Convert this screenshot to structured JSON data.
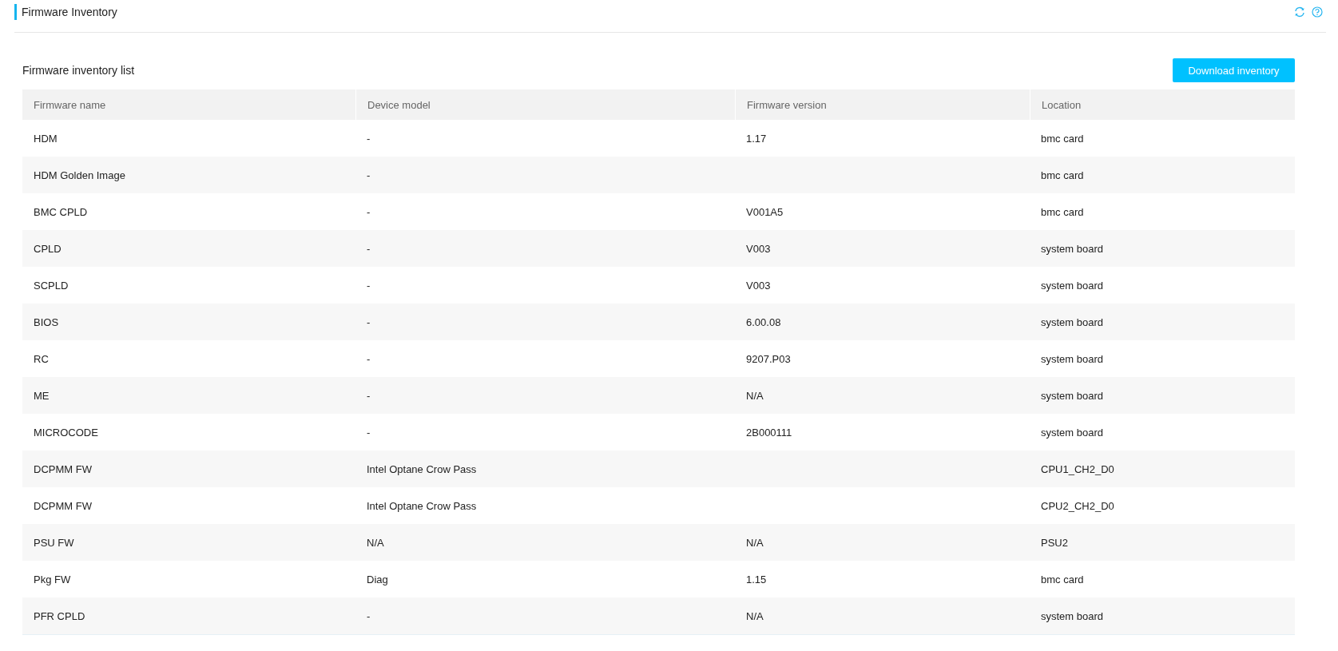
{
  "page": {
    "title": "Firmware Inventory"
  },
  "section": {
    "title": "Firmware inventory list",
    "button": "Download inventory"
  },
  "table": {
    "columns": [
      "Firmware name",
      "Device model",
      "Firmware version",
      "Location"
    ],
    "rows": [
      {
        "name": "HDM",
        "model": "-",
        "version": "1.17",
        "location": "bmc card"
      },
      {
        "name": "HDM Golden Image",
        "model": "-",
        "location": "bmc card"
      },
      {
        "name": "BMC CPLD",
        "model": "-",
        "version": "V001A5",
        "location": "bmc card"
      },
      {
        "name": "CPLD",
        "model": "-",
        "version": "V003",
        "location": "system board"
      },
      {
        "name": "SCPLD",
        "model": "-",
        "version": "V003",
        "location": "system board"
      },
      {
        "name": "BIOS",
        "model": "-",
        "version": "6.00.08",
        "location": "system board"
      },
      {
        "name": "RC",
        "model": "-",
        "version": "9207.P03",
        "location": "system board"
      },
      {
        "name": "ME",
        "model": "-",
        "version": "N/A",
        "location": "system board"
      },
      {
        "name": "MICROCODE",
        "model": "-",
        "version": "2B000111",
        "location": "system board"
      },
      {
        "name": "DCPMM FW",
        "model": "Intel Optane Crow Pass",
        "location": "CPU1_CH2_D0"
      },
      {
        "name": "DCPMM FW",
        "model": "Intel Optane Crow Pass",
        "location": "CPU2_CH2_D0"
      },
      {
        "name": "PSU FW",
        "model": "N/A",
        "version": "N/A",
        "location": "PSU2"
      },
      {
        "name": "Pkg FW",
        "model": "Diag",
        "version": "1.15",
        "location": "bmc card"
      },
      {
        "name": "PFR CPLD",
        "model": "-",
        "version": "N/A",
        "location": "system board"
      }
    ]
  }
}
